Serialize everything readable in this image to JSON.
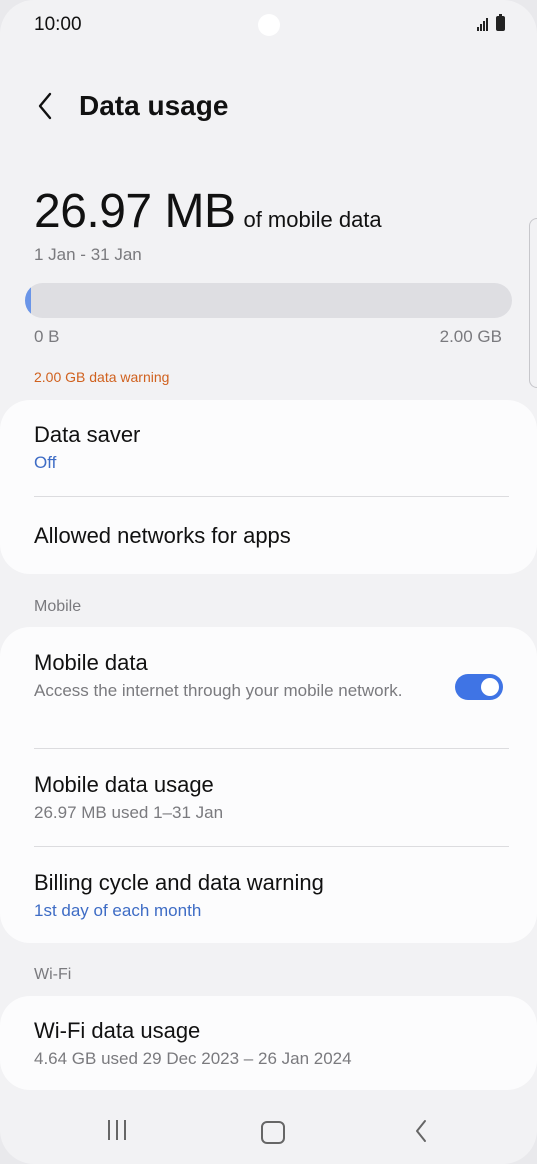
{
  "status_bar": {
    "time": "10:00",
    "icons": [
      "signal-icon",
      "battery-icon"
    ]
  },
  "header": {
    "back_icon": "chevron-left-icon",
    "title": "Data usage"
  },
  "usage": {
    "amount": "26.97 MB",
    "suffix": "of mobile data",
    "period": "1 Jan - 31 Jan",
    "bar_min": "0 B",
    "bar_max": "2.00 GB",
    "used_fraction": 0.013,
    "warning": "2.00 GB data warning",
    "bar_color": "#6a95e8",
    "warning_color": "#d0611e"
  },
  "settings_card": {
    "data_saver": {
      "title": "Data saver",
      "value": "Off"
    },
    "allowed_networks": {
      "title": "Allowed networks for apps"
    }
  },
  "mobile_section": {
    "header": "Mobile",
    "mobile_data": {
      "title": "Mobile data",
      "description": "Access the internet through your mobile network.",
      "toggle_on": true
    },
    "mobile_data_usage": {
      "title": "Mobile data usage",
      "subtitle": "26.97 MB used 1–31 Jan"
    },
    "billing_cycle": {
      "title": "Billing cycle and data warning",
      "subtitle": "1st day of each month"
    }
  },
  "wifi_section": {
    "header": "Wi-Fi",
    "wifi_data_usage": {
      "title": "Wi-Fi data usage",
      "subtitle": "4.64 GB used 29 Dec 2023 – 26 Jan 2024"
    }
  },
  "nav_bar": {
    "icons": [
      "recents-icon",
      "home-icon",
      "back-icon"
    ]
  },
  "colors": {
    "accent": "#3f74e5",
    "link_text": "#3e6cc5",
    "background": "#f2f2f4",
    "card": "#fcfcfd"
  }
}
